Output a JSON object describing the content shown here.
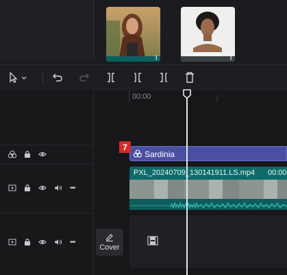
{
  "media": {
    "thumbnails": [
      {
        "name": "portrait-woman-red-hair"
      },
      {
        "name": "portrait-woman-curly-hair"
      }
    ]
  },
  "toolbar": {
    "tools": [
      "select-tool",
      "undo",
      "redo",
      "split",
      "split-left",
      "split-right",
      "delete"
    ]
  },
  "ruler": {
    "start_time": "00:00"
  },
  "tracks": {
    "text_clip": {
      "label": "Sardinia",
      "badge": "7"
    },
    "video_clip": {
      "filename": "PXL_20240709_130141911.LS.mp4",
      "timecode": "00:00"
    },
    "cover": {
      "label": "Cover"
    }
  },
  "colors": {
    "text_clip": "#4a4fa3",
    "video_clip": "#0f6b6a",
    "badge": "#d42a2a"
  }
}
